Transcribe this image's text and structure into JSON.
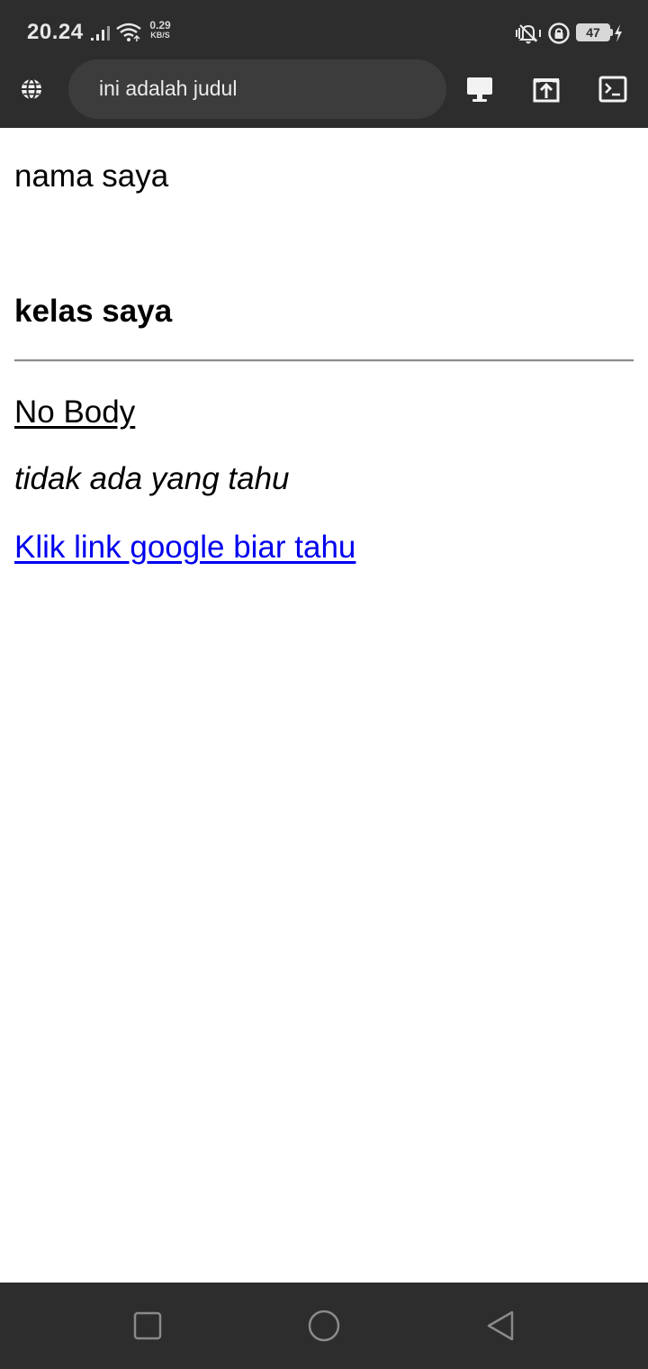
{
  "status_bar": {
    "time": "20.24",
    "net_speed_value": "0.29",
    "net_speed_unit": "KB/S",
    "battery_level": "47",
    "icons": [
      "signal-icon",
      "wifi-icon",
      "vibrate-icon",
      "rotation-lock-icon",
      "battery-icon",
      "charging-icon"
    ]
  },
  "browser_bar": {
    "url_text": "ini adalah judul",
    "icons": [
      "globe-icon",
      "desktop-icon",
      "share-icon",
      "console-icon"
    ]
  },
  "content": {
    "paragraph": "nama saya",
    "heading": "kelas saya",
    "underlined": "No Body",
    "italic": "tidak ada yang tahu",
    "link": "Klik link google biar tahu"
  },
  "nav_bar": {
    "icons": [
      "recents-icon",
      "home-icon",
      "back-icon"
    ]
  },
  "colors": {
    "chrome_bg": "#2d2d2d",
    "url_pill_bg": "#3c3c3c",
    "link": "#0000ee",
    "page_bg": "#ffffff"
  }
}
